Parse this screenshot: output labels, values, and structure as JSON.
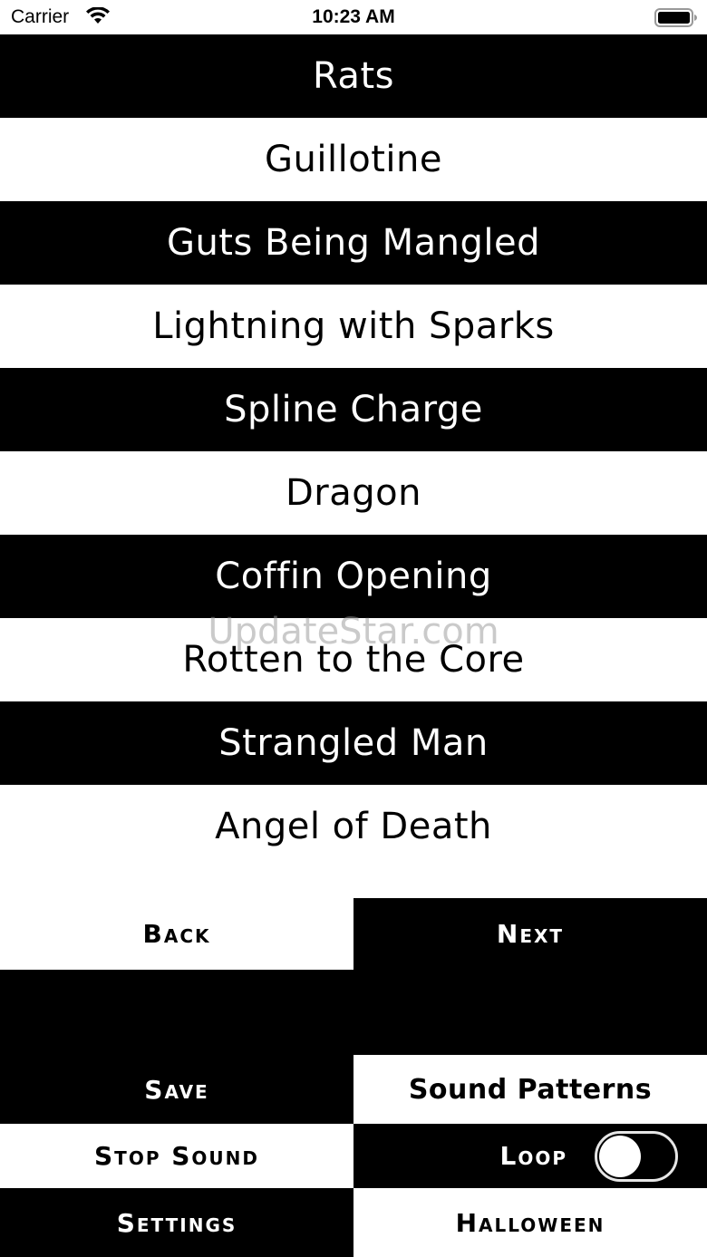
{
  "status_bar": {
    "carrier": "Carrier",
    "time": "10:23 AM",
    "wifi_icon": "wifi-icon",
    "battery_icon": "battery-icon"
  },
  "sounds": [
    {
      "label": "Rats",
      "theme": "dark"
    },
    {
      "label": "Guillotine",
      "theme": "light"
    },
    {
      "label": "Guts Being Mangled",
      "theme": "dark"
    },
    {
      "label": "Lightning with Sparks",
      "theme": "light"
    },
    {
      "label": "Spline Charge",
      "theme": "dark"
    },
    {
      "label": "Dragon",
      "theme": "light"
    },
    {
      "label": "Coffin Opening",
      "theme": "dark"
    },
    {
      "label": "Rotten to the Core",
      "theme": "light"
    },
    {
      "label": "Strangled Man",
      "theme": "dark"
    },
    {
      "label": "Angel of Death",
      "theme": "light"
    }
  ],
  "watermark": "UpdateStar.com",
  "nav": {
    "back_label": "Back",
    "next_label": "Next"
  },
  "controls": {
    "save_label": "Save",
    "sound_patterns_label": "Sound Patterns",
    "stop_sound_label": "Stop Sound",
    "loop_label": "Loop",
    "loop_on": false,
    "settings_label": "Settings",
    "halloween_label": "Halloween"
  },
  "colors": {
    "dark": "#000000",
    "light": "#ffffff"
  }
}
